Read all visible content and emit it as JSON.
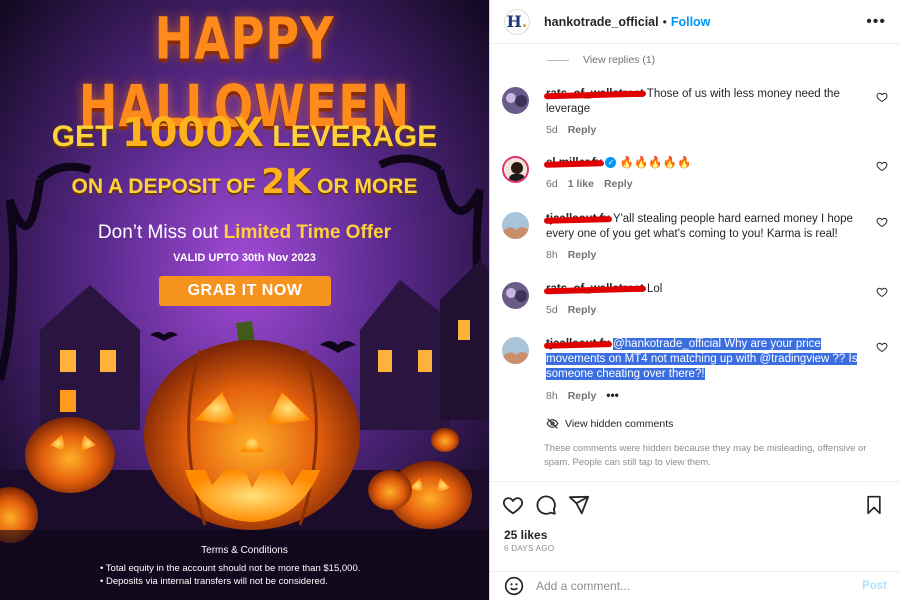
{
  "image": {
    "headline": "HAPPY HALLOWEEN",
    "offer_line1_pre": "GET ",
    "offer_line1_big": "1000X",
    "offer_line1_post": " LEVERAGE",
    "offer_line2_pre": "ON A DEPOSIT OF ",
    "offer_line2_big": "2K",
    "offer_line2_post": " OR MORE",
    "offer_line3_pre": "Don’t Miss out ",
    "offer_line3_bold": "Limited Time Offer",
    "valid": "VALID UPTO 30th Nov 2023",
    "cta": "GRAB IT NOW",
    "terms_title": "Terms & Conditions",
    "terms": [
      "Total equity in the account should not be more than $15,000.",
      "Deposits via internal transfers will not be considered."
    ]
  },
  "header": {
    "handle": "hankotrade_official",
    "separator": "•",
    "follow": "Follow",
    "more": "•••"
  },
  "comments": {
    "view_replies": "View replies (1)",
    "items": [
      {
        "user": "rats_of_wallstreet",
        "text": "Those of us with less money need the leverage",
        "age": "5d",
        "reply": "Reply"
      },
      {
        "user": "el.miller.fx",
        "text": "🔥🔥🔥🔥🔥",
        "age": "6d",
        "likes": "1 like",
        "reply": "Reply"
      },
      {
        "user": "tjcallsout.fx",
        "text": "Y'all stealing people hard earned money I hope every one of you get what's coming to you! Karma is real!",
        "age": "8h",
        "reply": "Reply"
      },
      {
        "user": "rats_of_wallstreet",
        "text": "Lol",
        "age": "5d",
        "reply": "Reply"
      },
      {
        "user": "tjcallsout.fx",
        "text": "@hankotrade_official Why are your price movements on MT4 not matching up with @tradingview ?? Is someone cheating over there?!",
        "age": "8h",
        "reply": "Reply",
        "more": "•••"
      }
    ],
    "hidden_link": "View hidden comments",
    "hidden_note": "These comments were hidden because they may be misleading, offensive or spam. People can still tap to view them."
  },
  "footer": {
    "likes": "25 likes",
    "ago": "6 DAYS AGO",
    "add_comment_placeholder": "Add a comment...",
    "post": "Post"
  },
  "colors": {
    "accent": "#0095f6",
    "highlight": "#3b6ee0",
    "cta": "#f6931e",
    "redaction": "#e00000"
  }
}
